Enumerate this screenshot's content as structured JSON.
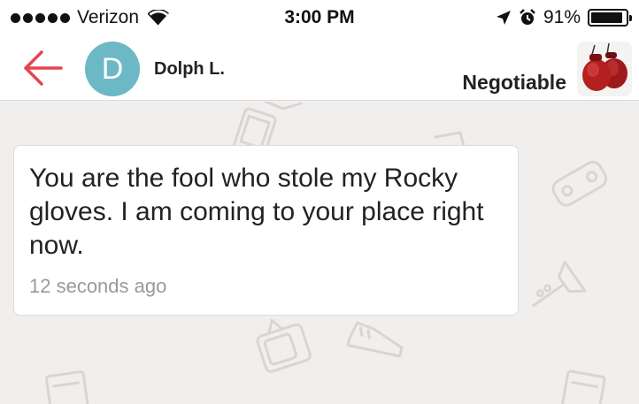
{
  "status_bar": {
    "carrier": "Verizon",
    "time": "3:00 PM",
    "battery": "91%",
    "battery_level": 0.91,
    "icons": [
      "signal-dots-icon",
      "wifi-icon",
      "location-arrow-icon",
      "alarm-icon",
      "battery-icon"
    ]
  },
  "header": {
    "avatar_initial": "D",
    "contact_name": "Dolph L.",
    "price_label": "Negotiable",
    "colors": {
      "back_arrow": "#e5454f",
      "avatar_bg": "#6db8c5"
    }
  },
  "messages": [
    {
      "text": "You are the fool who stole my Rocky gloves. I am coming to your place right now.",
      "time": "12 seconds ago"
    }
  ]
}
